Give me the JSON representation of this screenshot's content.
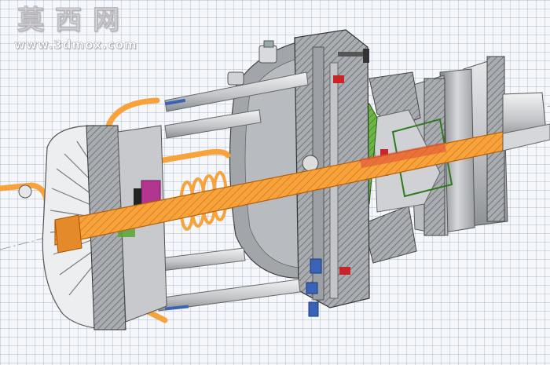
{
  "watermark": {
    "title": "莫西网",
    "url": "www.3dmox.com"
  },
  "colors": {
    "shaft": "#f7a23a",
    "metal": "#c9cbcf",
    "metal_dark": "#8f9296",
    "hatch": "#6e7174",
    "green_part": "#5aa532",
    "magenta_part": "#b2368f",
    "red_part": "#c8242a",
    "blue_bolt": "#3a63b8"
  }
}
